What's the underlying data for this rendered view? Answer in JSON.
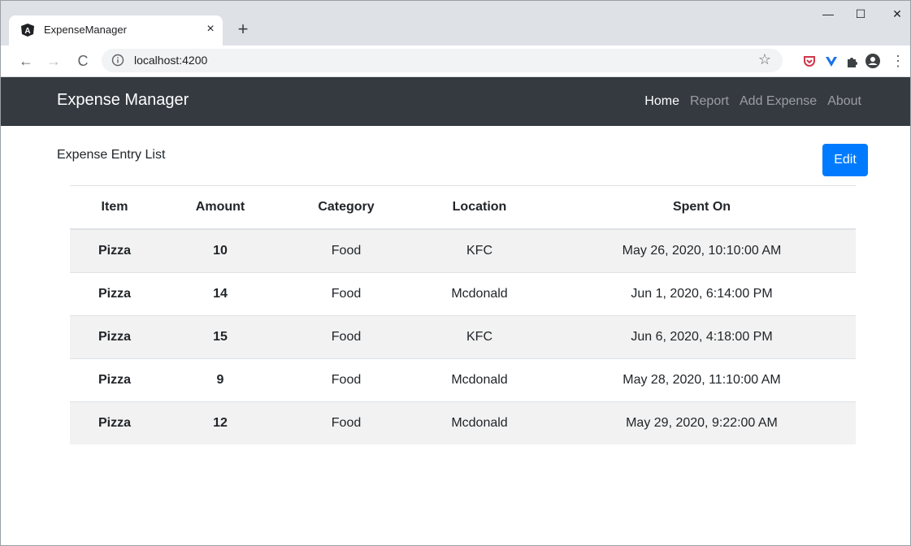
{
  "browser": {
    "tab_title": "ExpenseManager",
    "tab_close": "×",
    "new_tab": "+",
    "url": "localhost:4200",
    "window_controls": {
      "minimize": "—",
      "maximize": "☐",
      "close": "✕"
    },
    "nav": {
      "back": "←",
      "forward": "→",
      "reload": "C"
    },
    "bookmark_star": "☆",
    "menu": "⋮"
  },
  "app": {
    "brand": "Expense Manager",
    "nav_links": [
      {
        "label": "Home",
        "active": true
      },
      {
        "label": "Report",
        "active": false
      },
      {
        "label": "Add Expense",
        "active": false
      },
      {
        "label": "About",
        "active": false
      }
    ]
  },
  "page": {
    "title": "Expense Entry List",
    "edit_label": "Edit"
  },
  "table": {
    "headers": [
      "Item",
      "Amount",
      "Category",
      "Location",
      "Spent On"
    ],
    "rows": [
      {
        "item": "Pizza",
        "amount": "10",
        "category": "Food",
        "location": "KFC",
        "spent_on": "May 26, 2020, 10:10:00 AM"
      },
      {
        "item": "Pizza",
        "amount": "14",
        "category": "Food",
        "location": "Mcdonald",
        "spent_on": "Jun 1, 2020, 6:14:00 PM"
      },
      {
        "item": "Pizza",
        "amount": "15",
        "category": "Food",
        "location": "KFC",
        "spent_on": "Jun 6, 2020, 4:18:00 PM"
      },
      {
        "item": "Pizza",
        "amount": "9",
        "category": "Food",
        "location": "Mcdonald",
        "spent_on": "May 28, 2020, 11:10:00 AM"
      },
      {
        "item": "Pizza",
        "amount": "12",
        "category": "Food",
        "location": "Mcdonald",
        "spent_on": "May 29, 2020, 9:22:00 AM"
      }
    ]
  },
  "colors": {
    "navbar_bg": "#343a40",
    "primary_button": "#007bff",
    "stripe": "#f2f2f2"
  },
  "icons": [
    "angular-favicon-icon",
    "info-icon",
    "star-icon",
    "pocket-icon",
    "vue-icon",
    "extensions-icon",
    "profile-icon"
  ]
}
